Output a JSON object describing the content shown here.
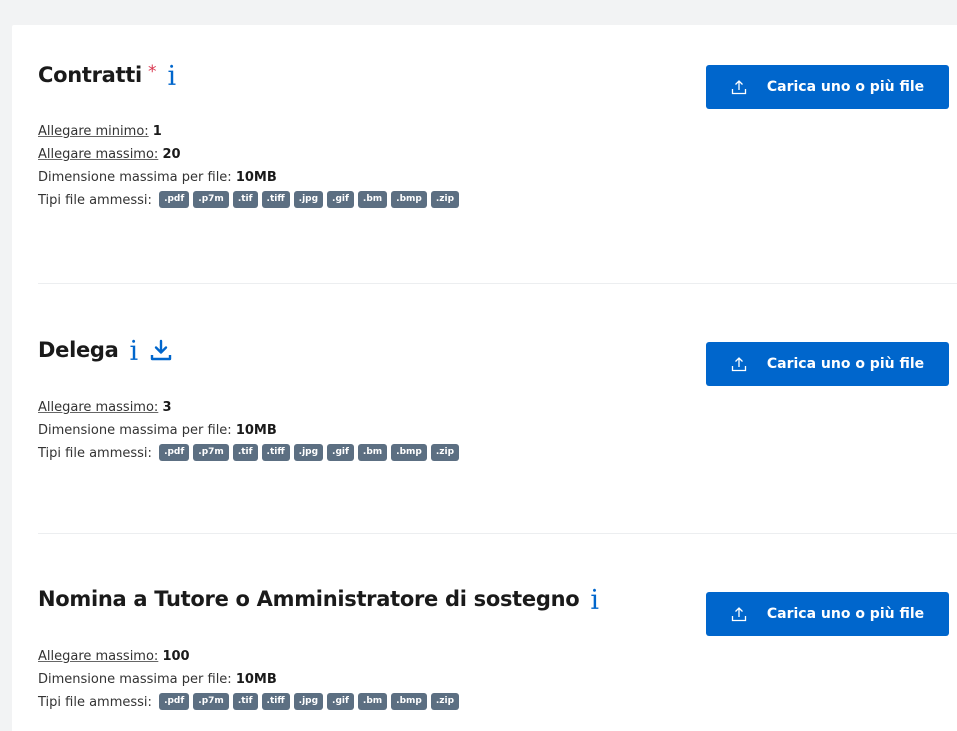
{
  "sections": [
    {
      "title": "Contratti",
      "required_mark": "*",
      "info_icon": "i",
      "has_download_icon": false,
      "button_label": "Carica uno o più file",
      "min_label": "Allegare minimo:",
      "min_value": "1",
      "max_label": "Allegare massimo:",
      "max_value": "20",
      "size_label": "Dimensione massima per file:",
      "size_value": "10MB",
      "types_label": "Tipi file ammessi:",
      "types": [
        ".pdf",
        ".p7m",
        ".tif",
        ".tiff",
        ".jpg",
        ".gif",
        ".bm",
        ".bmp",
        ".zip"
      ]
    },
    {
      "title": "Delega",
      "info_icon": "i",
      "has_download_icon": true,
      "button_label": "Carica uno o più file",
      "max_label": "Allegare massimo:",
      "max_value": "3",
      "size_label": "Dimensione massima per file:",
      "size_value": "10MB",
      "types_label": "Tipi file ammessi:",
      "types": [
        ".pdf",
        ".p7m",
        ".tif",
        ".tiff",
        ".jpg",
        ".gif",
        ".bm",
        ".bmp",
        ".zip"
      ]
    },
    {
      "title": "Nomina a Tutore o Amministratore di sostegno",
      "info_icon": "i",
      "has_download_icon": false,
      "button_label": "Carica uno o più file",
      "max_label": "Allegare massimo:",
      "max_value": "100",
      "size_label": "Dimensione massima per file:",
      "size_value": "10MB",
      "types_label": "Tipi file ammessi:",
      "types": [
        ".pdf",
        ".p7m",
        ".tif",
        ".tiff",
        ".jpg",
        ".gif",
        ".bm",
        ".bmp",
        ".zip"
      ]
    }
  ],
  "colors": {
    "primary": "#0066cc",
    "required": "#d9364f",
    "pill": "#5c6f82",
    "background": "#f2f3f4",
    "card": "#ffffff"
  },
  "icons": {
    "info": "info-icon",
    "download": "download-icon",
    "upload": "upload-icon"
  }
}
